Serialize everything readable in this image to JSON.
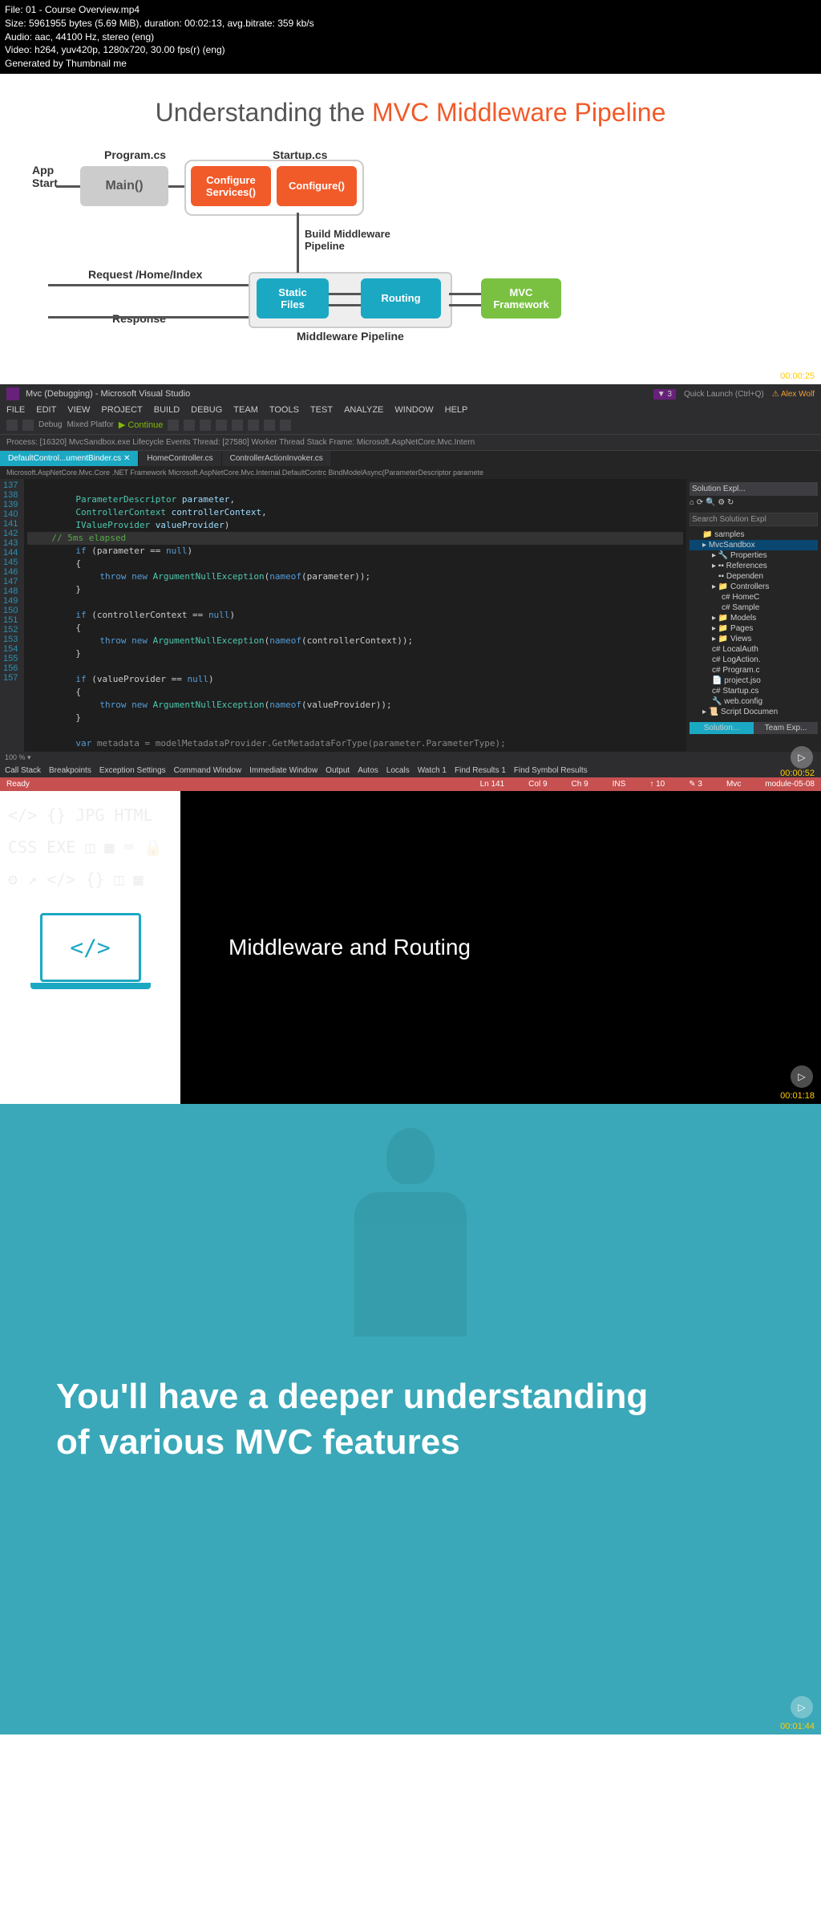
{
  "file_info": {
    "line1": "File: 01 - Course Overview.mp4",
    "line2": "Size: 5961955 bytes (5.69 MiB), duration: 00:02:13, avg.bitrate: 359 kb/s",
    "line3": "Audio: aac, 44100 Hz, stereo (eng)",
    "line4": "Video: h264, yuv420p, 1280x720, 30.00 fps(r) (eng)",
    "line5": "Generated by Thumbnail me"
  },
  "slide1": {
    "title_gray": "Understanding the ",
    "title_orange": "MVC Middleware Pipeline",
    "labels": {
      "app_start": "App\nStart",
      "program": "Program.cs",
      "startup": "Startup.cs",
      "main": "Main()",
      "config_services": "Configure\nServices()",
      "configure": "Configure()",
      "build_mw": "Build Middleware\nPipeline",
      "request": "Request /Home/Index",
      "response": "Response",
      "static_files": "Static\nFiles",
      "routing": "Routing",
      "mvc_fw": "MVC\nFramework",
      "mw_pipeline": "Middleware Pipeline"
    },
    "timestamp": "00:00:25"
  },
  "vs": {
    "title": "Mvc (Debugging) - Microsoft Visual Studio",
    "quick_launch": "Quick Launch (Ctrl+Q)",
    "user": "Alex Wolf",
    "notif_count": "3",
    "menu": [
      "FILE",
      "EDIT",
      "VIEW",
      "PROJECT",
      "BUILD",
      "DEBUG",
      "TEAM",
      "TOOLS",
      "TEST",
      "ANALYZE",
      "WINDOW",
      "HELP"
    ],
    "toolbar": {
      "continue": "Continue",
      "debug": "Debug",
      "platform": "Mixed Platfor"
    },
    "process": "Process: [16320] MvcSandbox.exe     Lifecycle Events   Thread: [27580] Worker Thread          Stack Frame: Microsoft.AspNetCore.Mvc.Intern",
    "tabs": {
      "active": "DefaultControl...umentBinder.cs",
      "t2": "HomeController.cs",
      "t3": "ControllerActionInvoker.cs"
    },
    "breadcrumb": "Microsoft.AspNetCore.Mvc.Core .NET Framework   Microsoft.AspNetCore.Mvc.Internal.DefaultContrc   BindModelAsync(ParameterDescriptor paramete",
    "lines": [
      "137",
      "138",
      "139",
      "140",
      "141",
      "142",
      "143",
      "144",
      "145",
      "146",
      "147",
      "148",
      "149",
      "150",
      "151",
      "152",
      "153",
      "154",
      "155",
      "156",
      "157"
    ],
    "explorer": {
      "title": "Solution Expl...",
      "search": "Search Solution Expl",
      "items": [
        "samples",
        "MvcSandbox",
        "Properties",
        "References",
        "Dependen",
        "Controllers",
        "HomeC",
        "Sample",
        "Models",
        "Pages",
        "Views",
        "LocalAuth",
        "LogAction.",
        "Program.c",
        "project.jso",
        "Startup.cs",
        "web.config",
        "Script Documen"
      ],
      "bottom_tabs": {
        "left": "Solution...",
        "right": "Team Exp..."
      }
    },
    "bottom_tabs": [
      "Call Stack",
      "Breakpoints",
      "Exception Settings",
      "Command Window",
      "Immediate Window",
      "Output",
      "Autos",
      "Locals",
      "Watch 1",
      "Find Results 1",
      "Find Symbol Results"
    ],
    "status": {
      "ready": "Ready",
      "ln": "Ln 141",
      "col": "Col 9",
      "ch": "Ch 9",
      "ins": "INS",
      "uploads": "↑ 10",
      "changes": "✎ 3",
      "branch": "Mvc",
      "module": "module-05-08"
    },
    "timestamp": "00:00:52",
    "code": {
      "l138": "ParameterDescriptor parameter,",
      "l139": "ControllerContext controllerContext,",
      "l140": "IValueProvider valueProvider)",
      "l141_comment": "// 5ms elapsed",
      "l142": "if (parameter == null)",
      "l144": "throw new ArgumentNullException(nameof(parameter));",
      "l147": "if (controllerContext == null)",
      "l149": "throw new ArgumentNullException(nameof(controllerContext));",
      "l152": "if (valueProvider == null)",
      "l154": "throw new ArgumentNullException(nameof(valueProvider));",
      "l157": "var metadata = modelMetadataProvider.GetMetadataForType(parameter.ParameterType);"
    }
  },
  "slide3": {
    "text": "Middleware and Routing",
    "timestamp": "00:01:18"
  },
  "slide4": {
    "line1": "You'll have a deeper understanding",
    "line2": "of various MVC features",
    "timestamp": "00:01:44"
  }
}
